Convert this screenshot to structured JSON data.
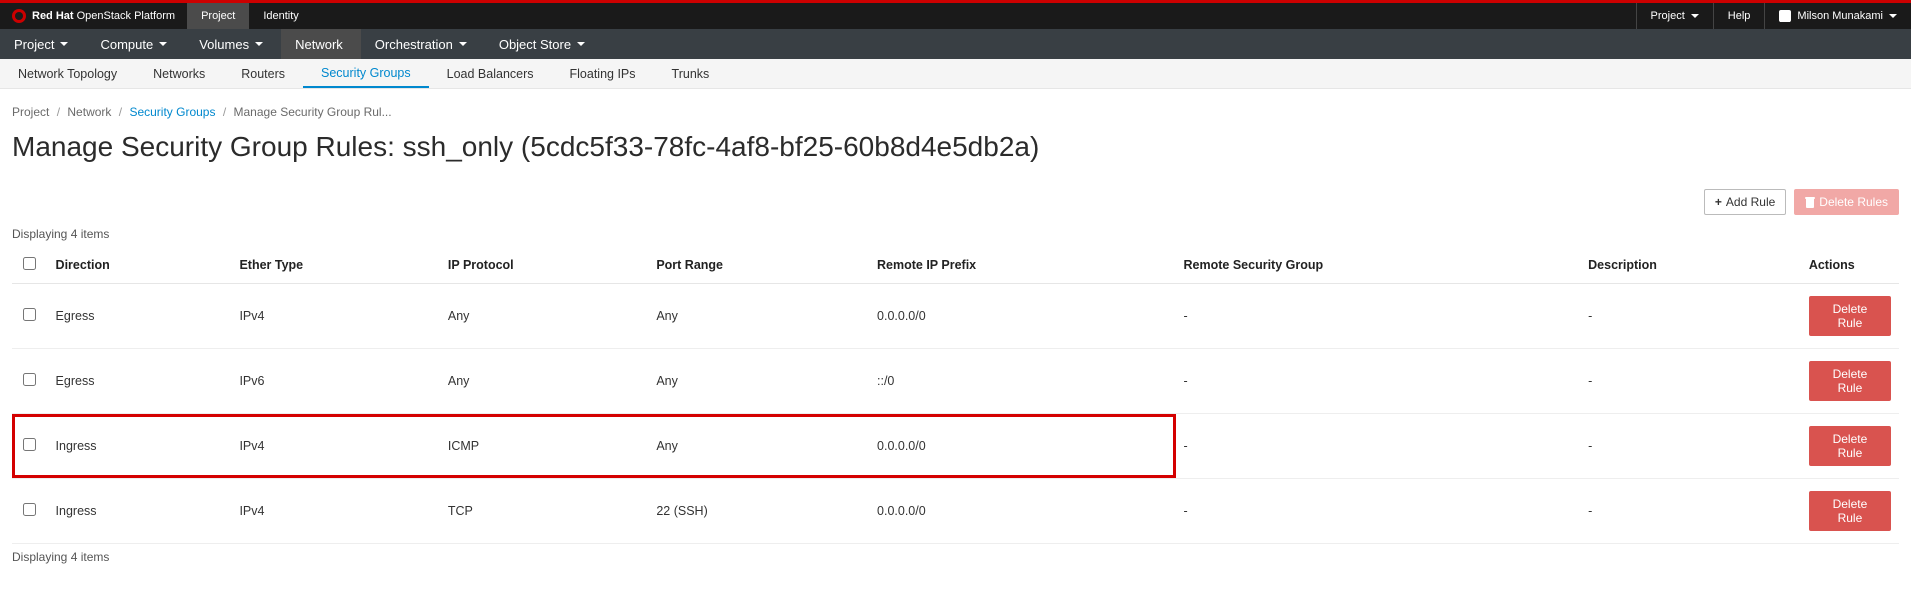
{
  "brand": {
    "bold": "Red Hat",
    "rest": " OpenStack Platform"
  },
  "topTabs": {
    "project": "Project",
    "identity": "Identity"
  },
  "topRight": {
    "project": "Project",
    "help": "Help",
    "user": "Milson Munakami"
  },
  "nav": {
    "project": "Project",
    "compute": "Compute",
    "volumes": "Volumes",
    "network": "Network",
    "orchestration": "Orchestration",
    "objectstore": "Object Store"
  },
  "subnav": {
    "topology": "Network Topology",
    "networks": "Networks",
    "routers": "Routers",
    "security": "Security Groups",
    "lb": "Load Balancers",
    "fip": "Floating IPs",
    "trunks": "Trunks"
  },
  "breadcrumb": {
    "project": "Project",
    "network": "Network",
    "security": "Security Groups",
    "current": "Manage Security Group Rul..."
  },
  "page_title": "Manage Security Group Rules: ssh_only (5cdc5f33-78fc-4af8-bf25-60b8d4e5db2a)",
  "buttons": {
    "add": "Add Rule",
    "delete_all": "Delete Rules",
    "delete_one": "Delete Rule"
  },
  "counter": "Displaying 4 items",
  "columns": {
    "direction": "Direction",
    "ether": "Ether Type",
    "proto": "IP Protocol",
    "port": "Port Range",
    "prefix": "Remote IP Prefix",
    "group": "Remote Security Group",
    "desc": "Description",
    "actions": "Actions"
  },
  "rows": [
    {
      "direction": "Egress",
      "ether": "IPv4",
      "proto": "Any",
      "port": "Any",
      "prefix": "0.0.0.0/0",
      "group": "-",
      "desc": "-",
      "hl": false
    },
    {
      "direction": "Egress",
      "ether": "IPv6",
      "proto": "Any",
      "port": "Any",
      "prefix": "::/0",
      "group": "-",
      "desc": "-",
      "hl": false
    },
    {
      "direction": "Ingress",
      "ether": "IPv4",
      "proto": "ICMP",
      "port": "Any",
      "prefix": "0.0.0.0/0",
      "group": "-",
      "desc": "-",
      "hl": true
    },
    {
      "direction": "Ingress",
      "ether": "IPv4",
      "proto": "TCP",
      "port": "22 (SSH)",
      "prefix": "0.0.0.0/0",
      "group": "-",
      "desc": "-",
      "hl": false
    }
  ]
}
